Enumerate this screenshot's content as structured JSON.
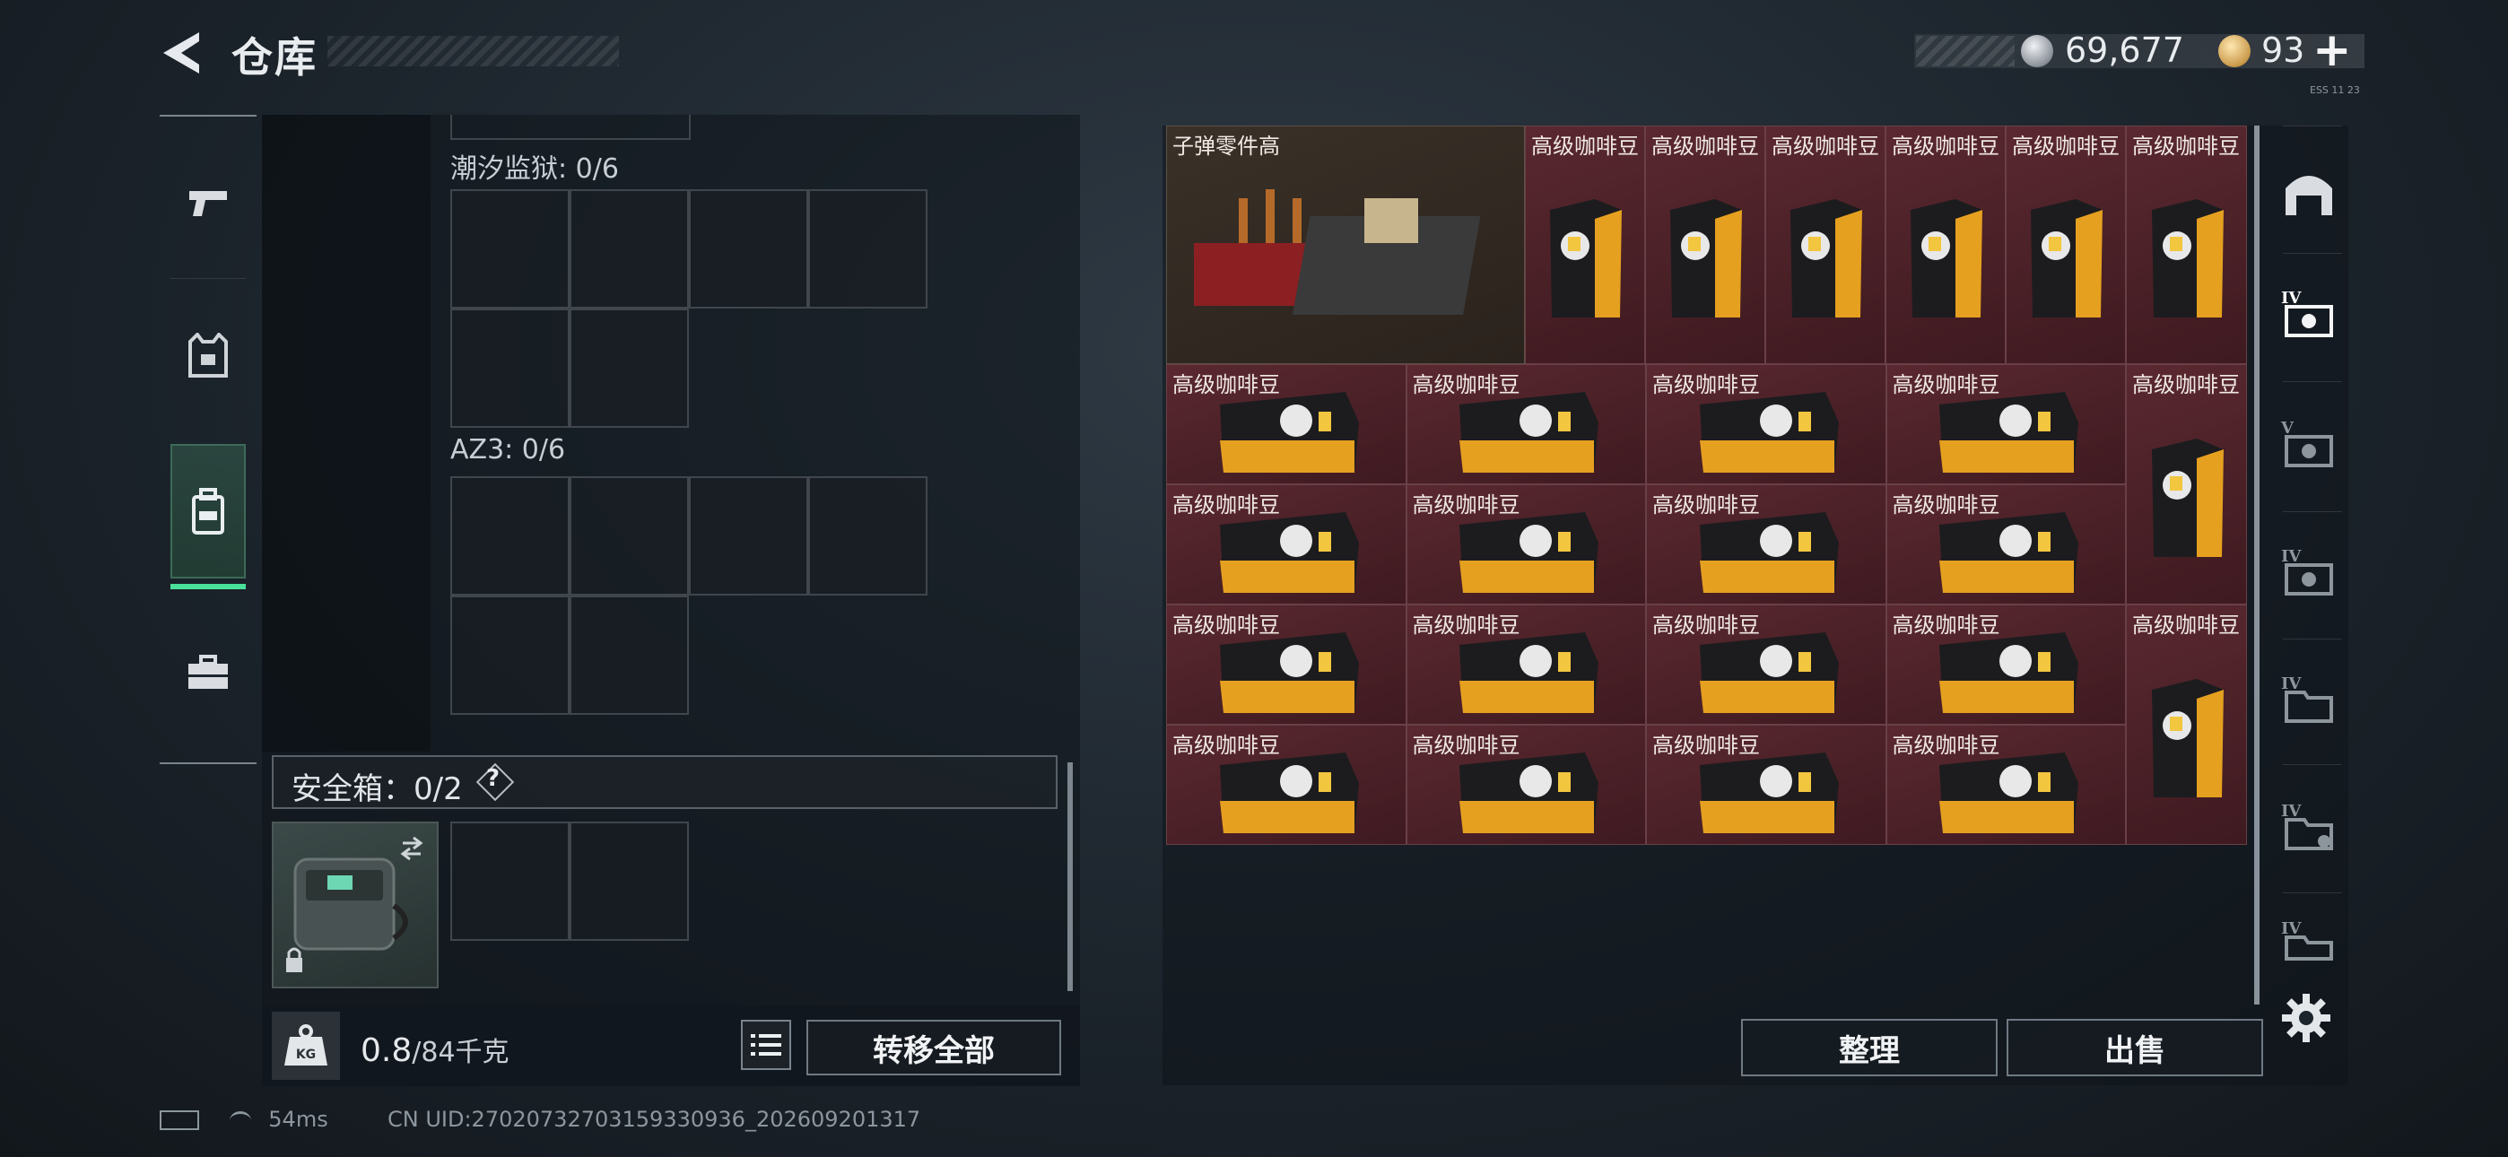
{
  "header": {
    "title": "仓库",
    "back_icon": "back-arrow-icon"
  },
  "currency": {
    "silver_amount": "69,677",
    "gold_amount": "93",
    "plus_label": "+"
  },
  "top_tiny_text": "ESS 11 23",
  "left_rail": {
    "items": [
      {
        "icon": "pistol-icon",
        "active": false
      },
      {
        "icon": "armor-vest-icon",
        "active": false
      },
      {
        "icon": "backpack-icon",
        "active": true
      },
      {
        "icon": "toolbox-icon",
        "active": false
      }
    ]
  },
  "container": {
    "sections": [
      {
        "label": "潮汐监狱: 0/6"
      },
      {
        "label": "AZ3: 0/6"
      }
    ],
    "safebox_label": "安全箱：0/2",
    "safebox_help": "?",
    "weight_value": "0.8",
    "weight_max": "/84千克",
    "kg_label": "KG",
    "transfer_all_label": "转移全部"
  },
  "stash": {
    "big_item_label": "子弹零件高",
    "item_label": "高级咖啡豆",
    "tidy_label": "整理",
    "sell_label": "出售"
  },
  "right_column": {
    "items": [
      {
        "icon": "garage-icon"
      },
      {
        "icon": "stash-tier-iv-icon-1",
        "tier": "IV"
      },
      {
        "icon": "stash-tier-v-icon",
        "tier": "V"
      },
      {
        "icon": "stash-tier-iv-icon-2",
        "tier": "IV"
      },
      {
        "icon": "stash-tier-iv-icon-3",
        "tier": "IV"
      },
      {
        "icon": "stash-tier-iv-icon-4",
        "tier": "IV"
      },
      {
        "icon": "stash-tier-iv-icon-5",
        "tier": "IV"
      }
    ],
    "settings_icon": "gear-icon"
  },
  "status_bar": {
    "ping": "54ms",
    "uid": "CN UID:2702073270315933093­6_202609201317"
  },
  "colors": {
    "accent_green": "#49e09a",
    "item_bg": "#5a2830"
  }
}
